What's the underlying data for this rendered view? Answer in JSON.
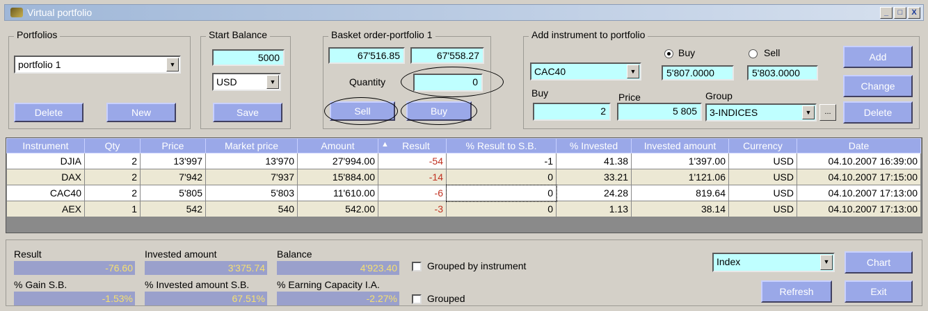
{
  "window": {
    "title": "Virtual portfolio"
  },
  "portfolios": {
    "legend": "Portfolios",
    "selected": "portfolio 1",
    "delete_label": "Delete",
    "new_label": "New"
  },
  "start_balance": {
    "legend": "Start Balance",
    "value": "5000",
    "currency": "USD",
    "save_label": "Save"
  },
  "basket": {
    "legend": "Basket order-portfolio 1",
    "value1": "67'516.85",
    "value2": "67'558.27",
    "quantity_label": "Quantity",
    "quantity": "0",
    "sell_label": "Sell",
    "buy_label": "Buy"
  },
  "add_instrument": {
    "legend": "Add instrument to portfolio",
    "instrument": "CAC40",
    "buy_radio": "Buy",
    "sell_radio": "Sell",
    "selected_side": "Buy",
    "buy_price": "5'807.0000",
    "sell_price": "5'803.0000",
    "buy_label": "Buy",
    "price_label": "Price",
    "group_label": "Group",
    "buy_qty": "2",
    "price": "5 805",
    "group": "3-INDICES",
    "ellipsis": "...",
    "add_label": "Add",
    "change_label": "Change",
    "delete_label": "Delete"
  },
  "table": {
    "sort_indicator": "▲",
    "columns": [
      "Instrument",
      "Qty",
      "Price",
      "Market price",
      "Amount",
      "Result",
      "% Result to S.B.",
      "% Invested",
      "Invested amount",
      "Currency",
      "Date"
    ],
    "rows": [
      [
        "DJIA",
        "2",
        "13'997",
        "13'970",
        "27'994.00",
        "-54",
        "-1",
        "41.38",
        "1'397.00",
        "USD",
        "04.10.2007 16:39:00"
      ],
      [
        "DAX",
        "2",
        "7'942",
        "7'937",
        "15'884.00",
        "-14",
        "0",
        "33.21",
        "1'121.06",
        "USD",
        "04.10.2007 17:15:00"
      ],
      [
        "CAC40",
        "2",
        "5'805",
        "5'803",
        "11'610.00",
        "-6",
        "0",
        "24.28",
        "819.64",
        "USD",
        "04.10.2007 17:13:00"
      ],
      [
        "AEX",
        "1",
        "542",
        "540",
        "542.00",
        "-3",
        "0",
        "1.13",
        "38.14",
        "USD",
        "04.10.2007 17:13:00"
      ]
    ]
  },
  "summary": {
    "result_label": "Result",
    "result": "-76.60",
    "invested_label": "Invested amount",
    "invested": "3'375.74",
    "balance_label": "Balance",
    "balance": "4'923.40",
    "gain_label": "% Gain S.B.",
    "gain": "-1.53%",
    "inv_sb_label": "% Invested amount S.B.",
    "inv_sb": "67.51%",
    "earn_label": "% Earning Capacity I.A.",
    "earn": "-2.27%",
    "grouped_by_instrument": "Grouped by instrument",
    "grouped": "Grouped",
    "chart_type": "Index",
    "chart_label": "Chart",
    "refresh_label": "Refresh",
    "exit_label": "Exit"
  },
  "colors": {
    "button": "#9aa8e8",
    "input": "#bfffff",
    "negative": "#c03020"
  }
}
